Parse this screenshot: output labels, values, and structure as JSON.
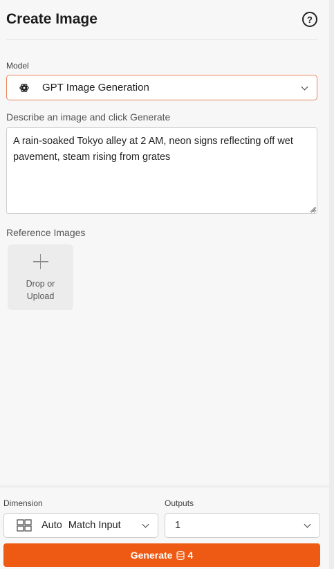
{
  "header": {
    "title": "Create Image",
    "help_icon": "help-circle-icon",
    "help_glyph": "?"
  },
  "model": {
    "label": "Model",
    "selected": "GPT Image Generation",
    "icon": "openai-logo-icon"
  },
  "prompt": {
    "label": "Describe an image and click Generate",
    "value": "A rain-soaked Tokyo alley at 2 AM, neon signs reflecting off wet pavement, steam rising from grates"
  },
  "reference": {
    "label": "Reference Images",
    "upload_text": "Drop or\nUpload"
  },
  "dimension": {
    "label": "Dimension",
    "value_primary": "Auto",
    "value_secondary": "Match Input",
    "icon": "layout-grid-icon"
  },
  "outputs": {
    "label": "Outputs",
    "value": "1"
  },
  "generate": {
    "label": "Generate",
    "credits": "4",
    "credit_icon": "database-coins-icon"
  },
  "colors": {
    "accent": "#ee5a13",
    "focus_border": "#e8845a"
  }
}
